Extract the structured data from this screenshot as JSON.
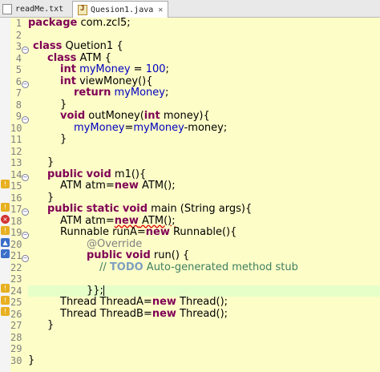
{
  "tabs": [
    {
      "label": "readMe.txt"
    },
    {
      "label": "Quesion1.java",
      "close": "✕"
    }
  ],
  "line_numbers": [
    "1",
    "2",
    "3",
    "4",
    "5",
    "6",
    "7",
    "8",
    "9",
    "10",
    "11",
    "12",
    "13",
    "14",
    "15",
    "16",
    "17",
    "18",
    "19",
    "20",
    "21",
    "22",
    "23",
    "24",
    "25",
    "26",
    "27",
    "28",
    "29",
    "30"
  ],
  "code": {
    "l1": {
      "kw": "package",
      "text": " com.zcl5;"
    },
    "l3": {
      "kw": "class",
      "text": " Quetion1 {"
    },
    "l4": {
      "kw": "class",
      "text": " ATM {"
    },
    "l5": {
      "kw": "int",
      "field": "myMoney",
      "text": " = ",
      "num": "100",
      "end": ";"
    },
    "l6": {
      "kw": "int",
      "text": " viewMoney(){"
    },
    "l7": {
      "kw": "return",
      "field": "myMoney",
      "end": ";"
    },
    "l8": {
      "text": "}"
    },
    "l9": {
      "kw": "void",
      "text": " outMoney(",
      "kw2": "int",
      "text2": " money){"
    },
    "l10": {
      "field1": "myMoney",
      "text": "=",
      "field2": "myMoney",
      "end": "-money;"
    },
    "l11": {
      "text": "}"
    },
    "l13": {
      "text": "}"
    },
    "l14": {
      "kw": "public",
      "kw2": "void",
      "text": " m1(){"
    },
    "l15": {
      "text1": "ATM atm=",
      "kw": "new",
      "text2": " ATM();"
    },
    "l16": {
      "text": "}"
    },
    "l17": {
      "kw": "public",
      "kw2": "static",
      "kw3": "void",
      "text": " main (String args){"
    },
    "l18": {
      "text1": "ATM atm=",
      "kw": "new",
      "text2": " ATM();"
    },
    "l19": {
      "text1": "Runnable runA=",
      "kw": "new",
      "text2": " Runnable(){"
    },
    "l20": {
      "ann": "@Override"
    },
    "l21": {
      "kw": "public",
      "kw2": "void",
      "text": " run() {"
    },
    "l22": {
      "comment": "// ",
      "todo": "TODO",
      "comment2": " Auto-generated method stub"
    },
    "l24": {
      "text": "}};"
    },
    "l25": {
      "text1": "Thread ThreadA=",
      "kw": "new",
      "text2": " Thread();"
    },
    "l26": {
      "text1": "Thread ThreadB=",
      "kw": "new",
      "text2": " Thread();"
    },
    "l27": {
      "text": "}"
    },
    "l30": {
      "text": "}"
    }
  },
  "colors": {
    "editor_bg": "#fdfdc8",
    "keyword": "#7f0055",
    "field": "#0000c0",
    "comment": "#3f7f5f",
    "current_line": "#e6ffc8"
  }
}
